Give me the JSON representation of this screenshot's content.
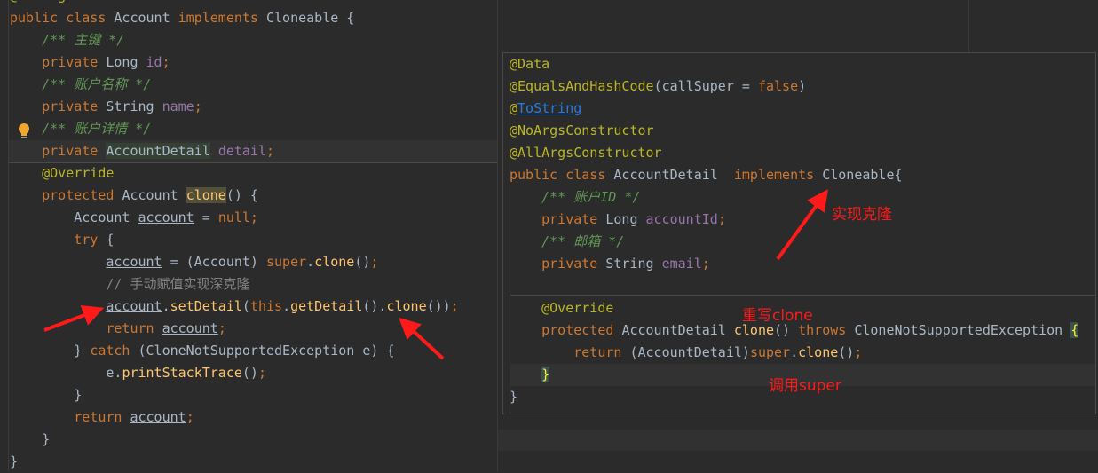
{
  "left_editor": {
    "lines": [
      [
        [
          "ann",
          "@AllArgsConstructor"
        ]
      ],
      [
        [
          "kw",
          "public class "
        ],
        [
          "txt",
          "Account "
        ],
        [
          "kw",
          "implements "
        ],
        [
          "txt",
          "Cloneable {"
        ]
      ],
      [
        [
          "txt",
          "    "
        ],
        [
          "doc",
          "/** 主键 */"
        ]
      ],
      [
        [
          "txt",
          "    "
        ],
        [
          "kw",
          "private "
        ],
        [
          "txt",
          "Long "
        ],
        [
          "fld",
          "id"
        ],
        [
          "kw",
          ";"
        ]
      ],
      [
        [
          "txt",
          "    "
        ],
        [
          "doc",
          "/** 账户名称 */"
        ]
      ],
      [
        [
          "txt",
          "    "
        ],
        [
          "kw",
          "private "
        ],
        [
          "txt",
          "String "
        ],
        [
          "fld",
          "name"
        ],
        [
          "kw",
          ";"
        ]
      ],
      [
        [
          "txt",
          "    "
        ],
        [
          "doc",
          "/** 账户详情 */"
        ]
      ],
      [
        [
          "txt",
          "    "
        ],
        [
          "kw",
          "private "
        ],
        [
          "txt hlType",
          "AccountDetail"
        ],
        [
          "txt",
          " "
        ],
        [
          "fld",
          "detail"
        ],
        [
          "kw",
          ";"
        ]
      ],
      [
        [
          "txt",
          "    "
        ],
        [
          "ann",
          "@Override"
        ]
      ],
      [
        [
          "txt",
          "    "
        ],
        [
          "kw",
          "protected "
        ],
        [
          "txt",
          "Account "
        ],
        [
          "mth hlM",
          "clone"
        ],
        [
          "txt",
          "() {"
        ]
      ],
      [
        [
          "txt",
          "        Account "
        ],
        [
          "txt var",
          "account"
        ],
        [
          "txt",
          " = "
        ],
        [
          "kw",
          "null;"
        ]
      ],
      [
        [
          "txt",
          "        "
        ],
        [
          "kw",
          "try "
        ],
        [
          "txt",
          "{"
        ]
      ],
      [
        [
          "txt",
          "            "
        ],
        [
          "txt var",
          "account"
        ],
        [
          "txt",
          " = (Account) "
        ],
        [
          "kw",
          "super"
        ],
        [
          "txt",
          "."
        ],
        [
          "mth",
          "clone"
        ],
        [
          "txt",
          "()"
        ],
        [
          "kw",
          ";"
        ]
      ],
      [
        [
          "txt",
          "            "
        ],
        [
          "cmt",
          "// 手动赋值实现深克隆"
        ]
      ],
      [
        [
          "txt",
          "            "
        ],
        [
          "txt var",
          "account"
        ],
        [
          "txt",
          "."
        ],
        [
          "mth",
          "setDetail"
        ],
        [
          "txt",
          "("
        ],
        [
          "kw",
          "this"
        ],
        [
          "txt",
          "."
        ],
        [
          "mth",
          "getDetail"
        ],
        [
          "txt",
          "()."
        ],
        [
          "mth",
          "clone"
        ],
        [
          "txt",
          "())"
        ],
        [
          "kw",
          ";"
        ]
      ],
      [
        [
          "txt",
          "            "
        ],
        [
          "kw",
          "return "
        ],
        [
          "txt var",
          "account"
        ],
        [
          "kw",
          ";"
        ]
      ],
      [
        [
          "txt",
          "        } "
        ],
        [
          "kw",
          "catch "
        ],
        [
          "txt",
          "(CloneNotSupportedException e) {"
        ]
      ],
      [
        [
          "txt",
          "            e."
        ],
        [
          "mth",
          "printStackTrace"
        ],
        [
          "txt",
          "()"
        ],
        [
          "kw",
          ";"
        ]
      ],
      [
        [
          "txt",
          "        }"
        ]
      ],
      [
        [
          "txt",
          "        "
        ],
        [
          "kw",
          "return "
        ],
        [
          "txt var",
          "account"
        ],
        [
          "kw",
          ";"
        ]
      ],
      [
        [
          "txt",
          "    }"
        ]
      ],
      [
        [
          "txt",
          "}"
        ]
      ]
    ]
  },
  "right_editor": {
    "lines": [
      [
        [
          "ann",
          "@Data"
        ]
      ],
      [
        [
          "ann",
          "@EqualsAndHashCode"
        ],
        [
          "txt",
          "(callSuper = "
        ],
        [
          "kw",
          "false"
        ],
        [
          "txt",
          ")"
        ]
      ],
      [
        [
          "ann",
          "@"
        ],
        [
          "lnk",
          "ToString"
        ]
      ],
      [
        [
          "ann",
          "@NoArgsConstructor"
        ]
      ],
      [
        [
          "ann",
          "@AllArgsConstructor"
        ]
      ],
      [
        [
          "kw",
          "public class "
        ],
        [
          "txt",
          "AccountDetail  "
        ],
        [
          "kw",
          "implements "
        ],
        [
          "txt",
          "Cloneable{"
        ]
      ],
      [
        [
          "txt",
          "    "
        ],
        [
          "doc",
          "/** 账户ID */"
        ]
      ],
      [
        [
          "txt",
          "    "
        ],
        [
          "kw",
          "private "
        ],
        [
          "txt",
          "Long "
        ],
        [
          "fld",
          "accountId"
        ],
        [
          "kw",
          ";"
        ]
      ],
      [
        [
          "txt",
          "    "
        ],
        [
          "doc",
          "/** 邮箱 */"
        ]
      ],
      [
        [
          "txt",
          "    "
        ],
        [
          "kw",
          "private "
        ],
        [
          "txt",
          "String "
        ],
        [
          "fld",
          "email"
        ],
        [
          "kw",
          ";"
        ]
      ],
      [
        [
          "txt",
          ""
        ]
      ],
      [
        [
          "txt",
          "    "
        ],
        [
          "ann",
          "@Override"
        ]
      ],
      [
        [
          "txt",
          "    "
        ],
        [
          "kw",
          "protected "
        ],
        [
          "txt",
          "AccountDetail "
        ],
        [
          "mth",
          "clone"
        ],
        [
          "txt",
          "() "
        ],
        [
          "kw",
          "throws "
        ],
        [
          "txt",
          "CloneNotSupportedException "
        ],
        [
          "brace",
          "{"
        ]
      ],
      [
        [
          "txt",
          "        "
        ],
        [
          "kw",
          "return "
        ],
        [
          "txt",
          "(AccountDetail)"
        ],
        [
          "kw",
          "super"
        ],
        [
          "txt",
          "."
        ],
        [
          "mth",
          "clone"
        ],
        [
          "txt",
          "()"
        ],
        [
          "kw",
          ";"
        ]
      ],
      [
        [
          "txt",
          "    "
        ],
        [
          "brace",
          "}"
        ]
      ],
      [
        [
          "txt",
          "}"
        ]
      ]
    ]
  },
  "annotations": {
    "implement_clone": "实现克隆",
    "override_clone": "重写clone",
    "call_super": "调用super"
  },
  "colors": {
    "arrow": "#ff1a1a",
    "keyword": "#cc7832",
    "comment": "#629755",
    "field": "#9876aa",
    "annotation": "#bbb529"
  },
  "icons": {
    "intention": "lightbulb-icon"
  }
}
